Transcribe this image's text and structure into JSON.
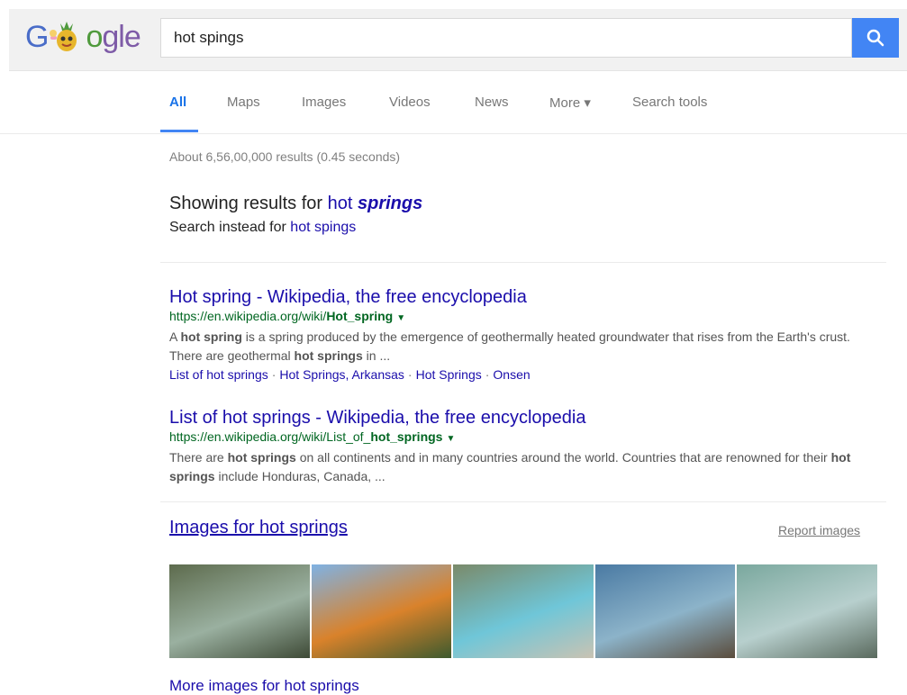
{
  "logo": {
    "text_parts": [
      "G",
      "gle"
    ]
  },
  "search": {
    "query": "hot spings"
  },
  "tabs": [
    {
      "label": "All"
    },
    {
      "label": "Maps"
    },
    {
      "label": "Images"
    },
    {
      "label": "Videos"
    },
    {
      "label": "News"
    },
    {
      "label": "More ▾"
    },
    {
      "label": "Search tools"
    }
  ],
  "stats": "About 6,56,00,000 results (0.45 seconds)",
  "correction": {
    "prefix": "Showing results for ",
    "plain": "hot ",
    "bold": "springs",
    "instead_prefix": "Search instead for ",
    "instead_link": "hot spings"
  },
  "results": [
    {
      "title": "Hot spring - Wikipedia, the free encyclopedia",
      "url_prefix": "https://en.wikipedia.org/wiki/",
      "url_bold": "Hot_spring",
      "snippet_html": "A <b>hot spring</b> is a spring produced by the emergence of geothermally heated groundwater that rises from the Earth's crust. There are geothermal <b>hot springs</b> in ...",
      "sitelinks": [
        "List of hot springs",
        "Hot Springs, Arkansas",
        "Hot Springs",
        "Onsen"
      ]
    },
    {
      "title": "List of hot springs - Wikipedia, the free encyclopedia",
      "url_prefix": "https://en.wikipedia.org/wiki/List_of_",
      "url_bold": "hot_springs",
      "snippet_html": "There are <b>hot springs</b> on all continents and in many countries around the world. Countries that are renowned for their <b>hot springs</b> include Honduras, Canada, ..."
    }
  ],
  "images": {
    "heading": "Images for hot springs",
    "report": "Report images",
    "more": "More images for hot springs",
    "thumb_colors": [
      [
        "#5d6b4d",
        "#9ab0a0",
        "#3e4a36"
      ],
      [
        "#7fb2e4",
        "#d9822b",
        "#3d5a2e"
      ],
      [
        "#7a8a6a",
        "#6fc6d8",
        "#c9c3b3"
      ],
      [
        "#4a7aa3",
        "#8cb3c9",
        "#5a4c3c"
      ],
      [
        "#7aa89e",
        "#b7cfcd",
        "#5a6a5e"
      ]
    ]
  },
  "colors": {
    "accent": "#4285f4",
    "link": "#1a0dab",
    "url": "#006621"
  }
}
